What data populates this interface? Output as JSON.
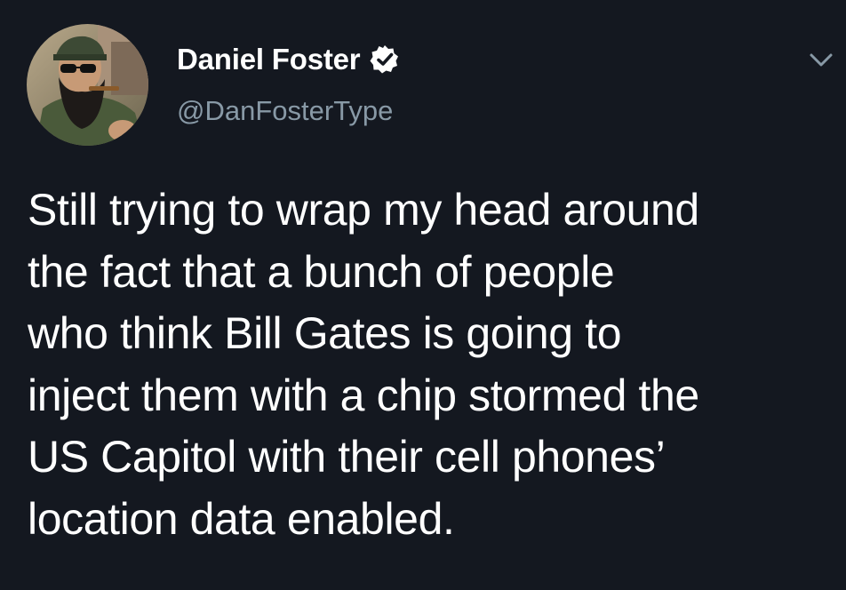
{
  "author": {
    "display_name": "Daniel Foster",
    "handle": "@DanFosterType",
    "verified": true,
    "avatar": "avatar-photo"
  },
  "tweet": {
    "text": "Still trying to wrap my head around\nthe fact that a bunch of people\nwho think Bill Gates is going to\ninject them with a chip stormed the\nUS Capitol with their cell phones’\nlocation data enabled."
  },
  "icons": {
    "verified": "verified-badge-icon",
    "menu": "chevron-down-icon"
  },
  "colors": {
    "background": "#141820",
    "text": "#ffffff",
    "secondary_text": "#8899a6"
  }
}
